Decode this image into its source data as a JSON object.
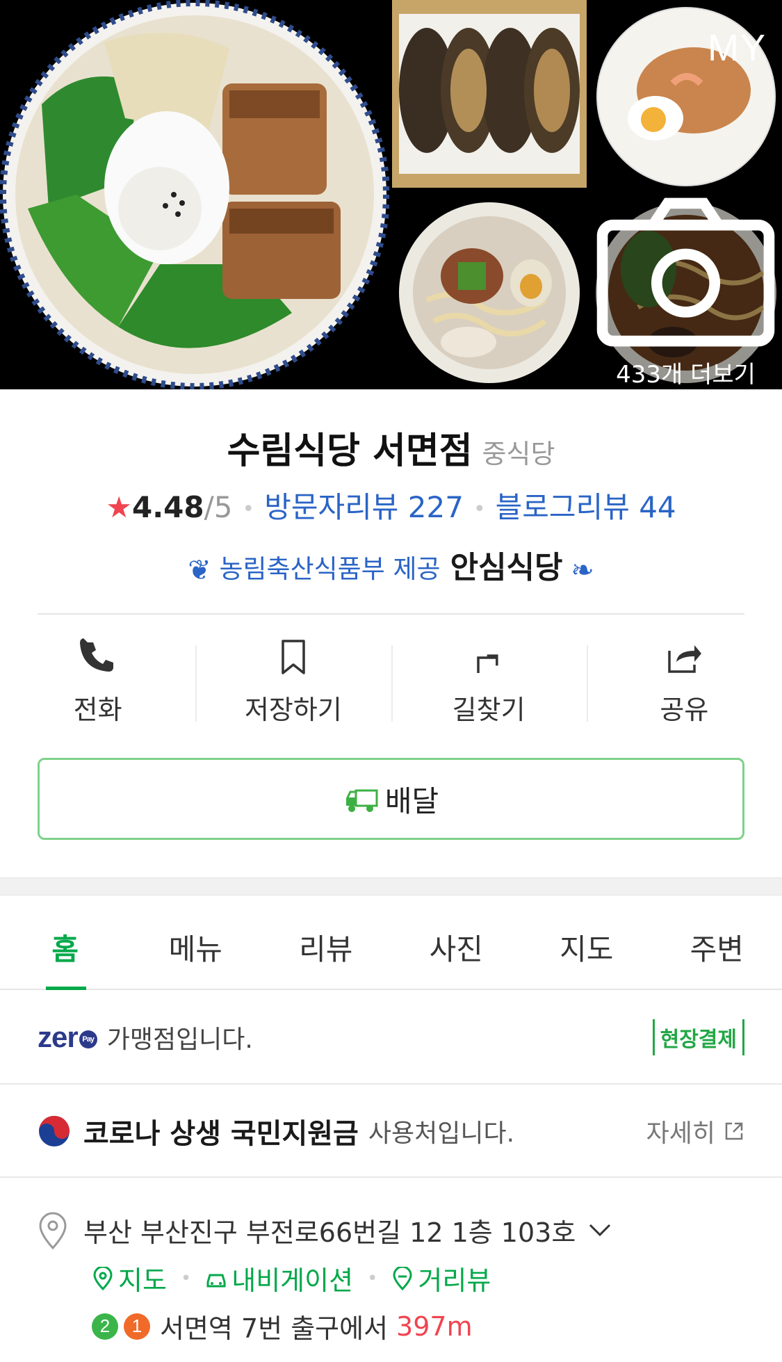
{
  "gallery": {
    "my_label": "MY",
    "more_text": "433개 더보기"
  },
  "place": {
    "name": "수림식당 서면점",
    "category": "중식당",
    "rating": "4.48",
    "rating_max": "/5",
    "visitor_reviews": "방문자리뷰 227",
    "blog_reviews": "블로그리뷰 44",
    "badge_provider": "농림축산식품부 제공",
    "badge_name": "안심식당"
  },
  "actions": [
    {
      "label": "전화",
      "icon": "phone-icon"
    },
    {
      "label": "저장하기",
      "icon": "bookmark-icon"
    },
    {
      "label": "길찾기",
      "icon": "directions-icon"
    },
    {
      "label": "공유",
      "icon": "share-icon"
    }
  ],
  "delivery": {
    "label": "배달",
    "color": "#7ed18a"
  },
  "tabs": [
    {
      "label": "홈",
      "active": true
    },
    {
      "label": "메뉴"
    },
    {
      "label": "리뷰"
    },
    {
      "label": "사진"
    },
    {
      "label": "지도"
    },
    {
      "label": "주변"
    }
  ],
  "zeropay": {
    "logo": "zer",
    "pay": "Pay",
    "text": "가맹점입니다.",
    "onsite": "현장결제"
  },
  "corona": {
    "strong": "코로나 상생 국민지원금",
    "text": "사용처입니다.",
    "detail": "자세히"
  },
  "address": {
    "text": "부산 부산진구 부전로66번길 12 1층 103호",
    "links": [
      "지도",
      "내비게이션",
      "거리뷰"
    ]
  },
  "subway": {
    "lines": [
      "2",
      "1"
    ],
    "station": "서면역",
    "exit": "7번 출구에서",
    "distance": "397m"
  },
  "colors": {
    "accent_green": "#03a84a",
    "link_blue": "#2a64c6",
    "star_red": "#f0444f"
  }
}
